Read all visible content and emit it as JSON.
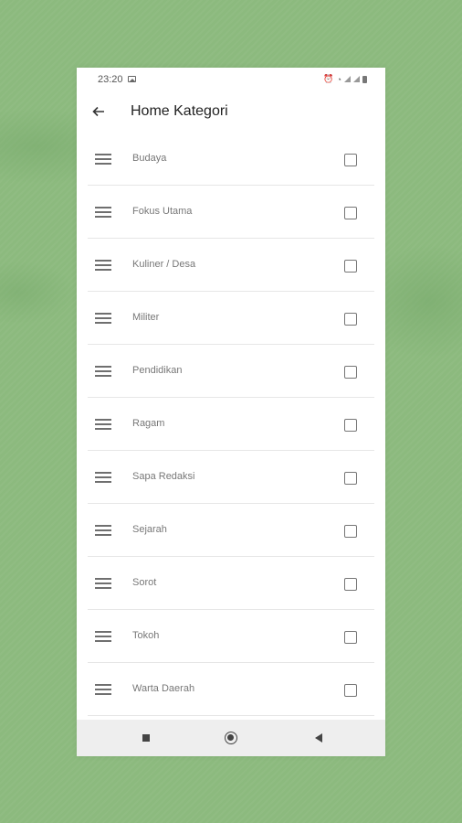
{
  "status_bar": {
    "time": "23:20",
    "icons": [
      "image-icon",
      "alarm-icon",
      "wifi-icon",
      "signal-icon",
      "signal-icon",
      "battery-icon"
    ]
  },
  "app_bar": {
    "back_icon": "arrow-left-icon",
    "title": "Home Kategori"
  },
  "categories": [
    {
      "label": "Budaya",
      "checked": false
    },
    {
      "label": "Fokus Utama",
      "checked": false
    },
    {
      "label": "Kuliner / Desa",
      "checked": false
    },
    {
      "label": "Militer",
      "checked": false
    },
    {
      "label": "Pendidikan",
      "checked": false
    },
    {
      "label": "Ragam",
      "checked": false
    },
    {
      "label": "Sapa Redaksi",
      "checked": false
    },
    {
      "label": "Sejarah",
      "checked": false
    },
    {
      "label": "Sorot",
      "checked": false
    },
    {
      "label": "Tokoh",
      "checked": false
    },
    {
      "label": "Warta Daerah",
      "checked": false
    }
  ],
  "nav_bar": {
    "buttons": [
      "recents-icon",
      "home-icon",
      "back-icon"
    ]
  },
  "colors": {
    "background": "#8cba7e",
    "surface": "#ffffff",
    "nav_bar": "#eeeeee"
  }
}
